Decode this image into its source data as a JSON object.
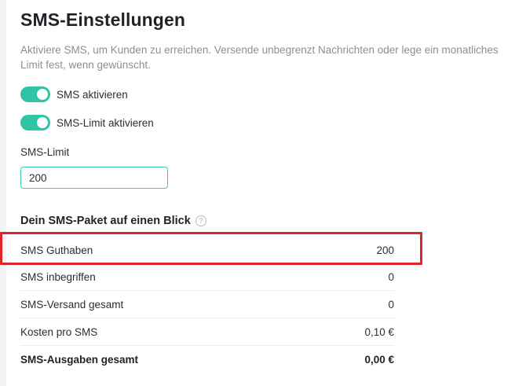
{
  "page": {
    "title": "SMS-Einstellungen",
    "description": "Aktiviere SMS, um Kunden zu erreichen. Versende unbegrenzt Nachrichten oder lege ein monatliches Limit fest, wenn gewünscht."
  },
  "toggles": [
    {
      "label": "SMS aktivieren",
      "enabled": true
    },
    {
      "label": "SMS-Limit aktivieren",
      "enabled": true
    }
  ],
  "limit_field": {
    "label": "SMS-Limit",
    "value": "200"
  },
  "package": {
    "title": "Dein SMS-Paket auf einen Blick",
    "help_icon": "question-circle-icon",
    "rows": [
      {
        "label": "SMS Guthaben",
        "value": "200"
      },
      {
        "label": "SMS inbegriffen",
        "value": "0"
      },
      {
        "label": "SMS-Versand gesamt",
        "value": "0"
      },
      {
        "label": "Kosten pro SMS",
        "value": "0,10 €"
      },
      {
        "label": "SMS-Ausgaben gesamt",
        "value": "0,00 €"
      }
    ]
  },
  "colors": {
    "accent": "#2ec4a5",
    "highlight": "#e0242b"
  }
}
